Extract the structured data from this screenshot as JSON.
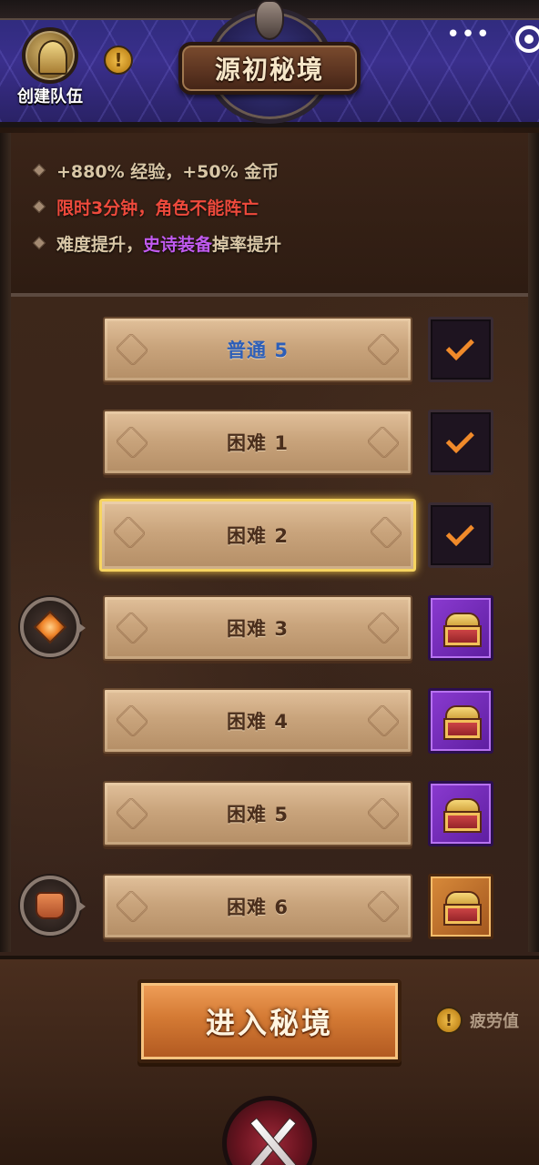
{
  "header": {
    "title": "源初秘境",
    "team_button_label": "创建队伍",
    "info_icon": "exclamation-info-icon",
    "menu_icon": "more-dots-icon",
    "close_icon": "capsule-close-icon"
  },
  "info": {
    "lines": [
      {
        "text": "+880% 经验，+50% 金币"
      },
      {
        "text": "限时3分钟，角色不能阵亡"
      },
      {
        "prefix": "难度提升，",
        "highlight": "史诗装备",
        "suffix": " 掉率提升"
      }
    ],
    "colors": {
      "normal": "#d8c6a6",
      "warning": "#ee4a3c",
      "epic": "#c05aee"
    }
  },
  "levels": [
    {
      "label": "普通 5",
      "status": "completed",
      "selected": false,
      "reward_icon": null
    },
    {
      "label": "困难 1",
      "status": "completed",
      "selected": false,
      "reward_icon": null
    },
    {
      "label": "困难 2",
      "status": "completed",
      "selected": true,
      "reward_icon": null
    },
    {
      "label": "困难 3",
      "status": "chest-epic",
      "selected": false,
      "reward_icon": "orange-gem-icon"
    },
    {
      "label": "困难 4",
      "status": "chest-epic",
      "selected": false,
      "reward_icon": null
    },
    {
      "label": "困难 5",
      "status": "chest-epic",
      "selected": false,
      "reward_icon": null
    },
    {
      "label": "困难 6",
      "status": "chest-legendary",
      "selected": false,
      "reward_icon": "armor-icon"
    }
  ],
  "footer": {
    "enter_button_label": "进入秘境",
    "fatigue_label": "疲劳值",
    "emblem_icon": "crossed-swords-icon"
  },
  "colors": {
    "accent_orange": "#f08a2a",
    "epic_purple": "#8a3ad0",
    "legendary_orange": "#d88a3a",
    "selected_gold": "#f6d460"
  }
}
